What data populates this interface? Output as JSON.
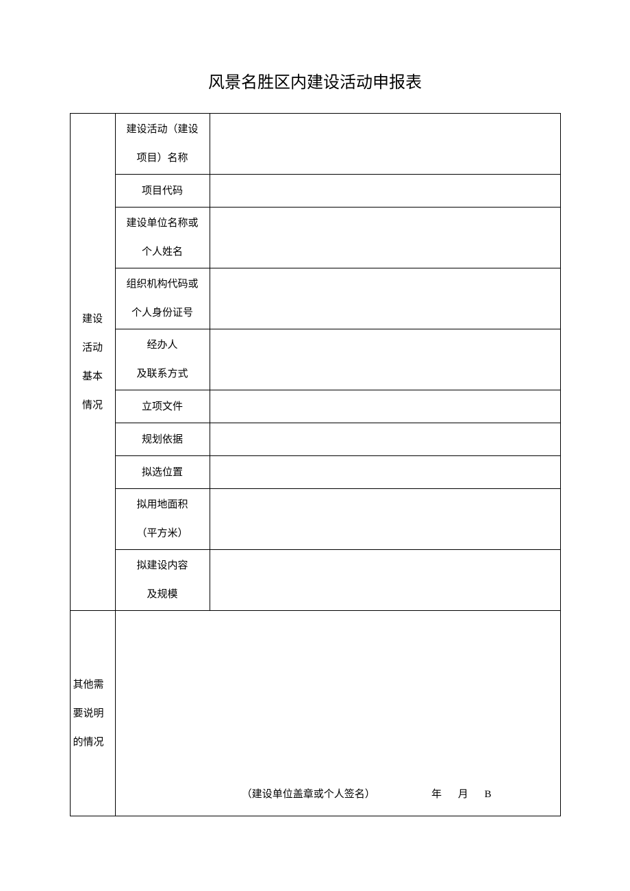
{
  "title": "风景名胜区内建设活动申报表",
  "section1_label": "建设\n活动\n基本\n情况",
  "rows": {
    "r1": {
      "label": "建设活动（建设\n项目）名称",
      "value": ""
    },
    "r2": {
      "label": "项目代码",
      "value": ""
    },
    "r3": {
      "label": "建设单位名称或\n个人姓名",
      "value": ""
    },
    "r4": {
      "label": "组织机构代码或\n个人身份证号",
      "value": ""
    },
    "r5": {
      "label": "经办人\n及联系方式",
      "value": ""
    },
    "r6": {
      "label": "立项文件",
      "value": ""
    },
    "r7": {
      "label": "规划依据",
      "value": ""
    },
    "r8": {
      "label": "拟选位置",
      "value": ""
    },
    "r9": {
      "label": "拟用地面积\n（平方米）",
      "value": ""
    },
    "r10": {
      "label": "拟建设内容\n及规模",
      "value": ""
    }
  },
  "section2_label": "其他需\n要说明\n的情况",
  "footer": {
    "seal_text": "（建设单位盖章或个人签名）",
    "year_label": "年",
    "month_label": "月",
    "day_label": "B"
  }
}
